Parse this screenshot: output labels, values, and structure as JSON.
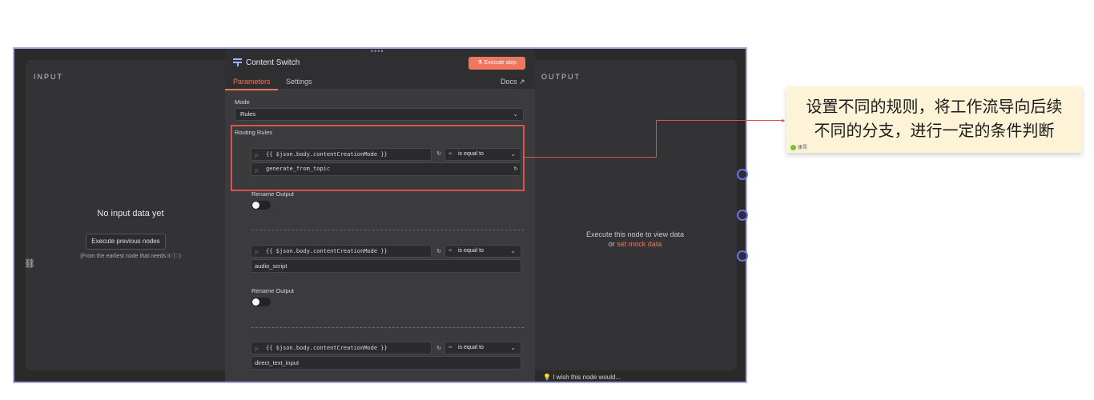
{
  "input_panel": {
    "title": "INPUT",
    "empty_message": "No input data yet",
    "execute_previous": "Execute previous nodes",
    "hint": "(From the earliest node that needs it ⓘ )"
  },
  "output_panel": {
    "title": "OUTPUT",
    "line1": "Execute this node to view data",
    "line2_prefix": "or ",
    "line2_link": "set mock data"
  },
  "node": {
    "title": "Content Switch",
    "execute_step": "Execute step",
    "tabs": {
      "parameters": "Parameters",
      "settings": "Settings"
    },
    "docs": "Docs",
    "mode_label": "Mode",
    "mode_value": "Rules",
    "routing_rules_label": "Routing Rules",
    "rules": [
      {
        "left_value": "{{ $json.body.contentCreationMode }}",
        "operator": "is equal to",
        "right_value": "generate_from_topic",
        "rename_output_label": "Rename Output"
      },
      {
        "left_value": "{{ $json.body.contentCreationMode }}",
        "operator": "is equal to",
        "right_value": "audio_script",
        "rename_output_label": "Rename Output"
      },
      {
        "left_value": "{{ $json.body.contentCreationMode }}",
        "operator": "is equal to",
        "right_value": "direct_text_input"
      }
    ]
  },
  "feedback": {
    "wish": "I wish this node would..."
  },
  "annotation": {
    "line1": "设置不同的规则，将工作流导向后续",
    "line2": "不同的分支，进行一定的条件判断",
    "author": "康晃"
  },
  "colors": {
    "accent": "#f0765f",
    "highlight": "#d9534f",
    "note_bg": "#fdf3d6"
  }
}
